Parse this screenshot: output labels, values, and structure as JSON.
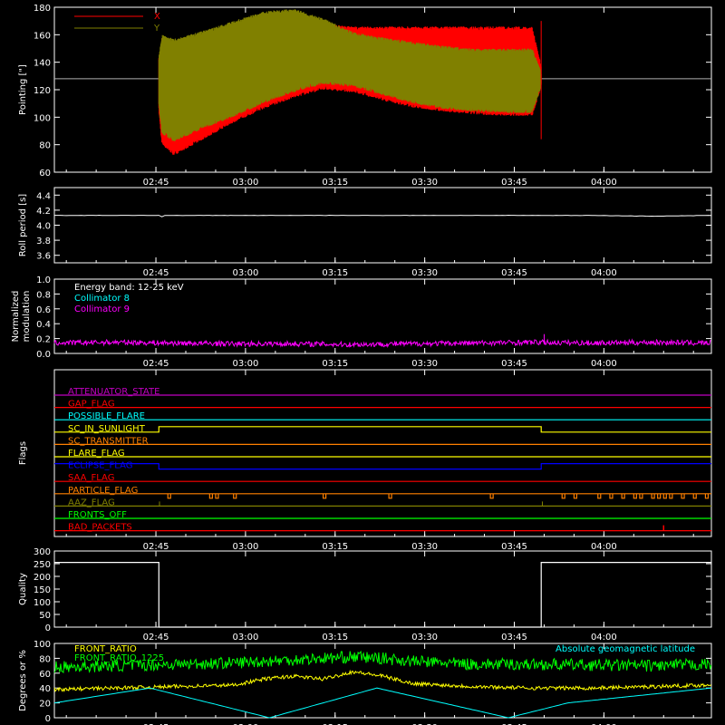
{
  "colors": {
    "background": "#000000",
    "axis": "#ffffff",
    "x_pointing": "#ff0000",
    "y_pointing": "#808000",
    "white": "#ffffff",
    "cyan": "#00ffff",
    "magenta": "#ff00ff",
    "green": "#00ff00",
    "yellow": "#ffff00",
    "orange": "#ff8000",
    "blue": "#0000ff",
    "purple": "#c000c0",
    "red": "#ff0000"
  },
  "time_axis": {
    "ticks": [
      "02:45",
      "03:00",
      "03:15",
      "03:30",
      "03:45",
      "04:00"
    ]
  },
  "chart_data": [
    {
      "id": "pointing",
      "type": "line",
      "ylabel": "Pointing [\"]",
      "ylim": [
        60,
        180
      ],
      "yticks": [
        "60",
        "80",
        "100",
        "120",
        "140",
        "160",
        "180"
      ],
      "xlim_minutes": [
        0,
        110
      ],
      "legend_placement": "top-left",
      "reference_line": 128,
      "series": [
        {
          "name": "X",
          "color": "#ff0000",
          "time_minutes": [
            0,
            17,
            18,
            20,
            25,
            30,
            35,
            40,
            45,
            50,
            55,
            60,
            65,
            70,
            75,
            80,
            82
          ],
          "upper": [
            128,
            128,
            158,
            152,
            158,
            164,
            170,
            170,
            168,
            166,
            166,
            166,
            166,
            166,
            166,
            166,
            128
          ],
          "lower": [
            128,
            128,
            80,
            72,
            84,
            96,
            106,
            114,
            120,
            118,
            112,
            107,
            104,
            102,
            101,
            101,
            128
          ]
        },
        {
          "name": "Y",
          "color": "#808000",
          "time_minutes": [
            0,
            17,
            18,
            20,
            25,
            30,
            35,
            40,
            45,
            50,
            55,
            60,
            65,
            70,
            75,
            80,
            82
          ],
          "upper": [
            128,
            128,
            160,
            157,
            163,
            170,
            177,
            179,
            172,
            162,
            158,
            155,
            152,
            150,
            150,
            150,
            128
          ],
          "lower": [
            128,
            128,
            88,
            82,
            92,
            100,
            110,
            118,
            124,
            122,
            116,
            110,
            106,
            104,
            103,
            103,
            128
          ]
        }
      ]
    },
    {
      "id": "roll_period",
      "type": "line",
      "ylabel": "Roll period [s]",
      "ylim": [
        3.5,
        4.5
      ],
      "yticks": [
        "3.6",
        "3.8",
        "4.0",
        "4.2",
        "4.4"
      ],
      "xlim_minutes": [
        0,
        110
      ],
      "series": [
        {
          "name": "",
          "color": "#ffffff",
          "time_minutes": [
            0,
            10,
            20,
            30,
            40,
            50,
            60,
            70,
            80,
            90,
            100,
            110
          ],
          "values": [
            4.13,
            4.13,
            4.13,
            4.13,
            4.13,
            4.13,
            4.13,
            4.13,
            4.13,
            4.13,
            4.12,
            4.13
          ]
        }
      ]
    },
    {
      "id": "modulation",
      "type": "line",
      "ylabel_lines": [
        "Normalized",
        "modulation"
      ],
      "ylim": [
        0,
        1.0
      ],
      "yticks": [
        "0.0",
        "0.2",
        "0.4",
        "0.6",
        "0.8",
        "1.0"
      ],
      "xlim_minutes": [
        0,
        110
      ],
      "legend": [
        {
          "label": "Energy band: 12-25 keV",
          "color": "#ffffff"
        },
        {
          "label": "Collimator 8",
          "color": "#00ffff"
        },
        {
          "label": "Collimator 9",
          "color": "#ff00ff"
        }
      ],
      "series": [
        {
          "name": "Collimator 9",
          "color": "#ff00ff",
          "time_minutes": [
            0,
            10,
            20,
            30,
            40,
            50,
            60,
            70,
            80,
            90,
            100,
            110
          ],
          "values": [
            0.14,
            0.15,
            0.14,
            0.13,
            0.13,
            0.12,
            0.13,
            0.14,
            0.15,
            0.14,
            0.15,
            0.14
          ]
        }
      ]
    },
    {
      "id": "flags",
      "type": "line",
      "ylabel": "Flags",
      "xlim_minutes": [
        0,
        110
      ],
      "rows": [
        {
          "label": "ATTENUATOR_STATE",
          "color": "#c000c0",
          "segments": [
            [
              0,
              110,
              0
            ]
          ]
        },
        {
          "label": "GAP_FLAG",
          "color": "#ff0000",
          "segments": [
            [
              0,
              110,
              0
            ]
          ]
        },
        {
          "label": "POSSIBLE_FLARE",
          "color": "#00ffff",
          "segments": [
            [
              0,
              110,
              0
            ]
          ]
        },
        {
          "label": "SC_IN_SUNLIGHT",
          "color": "#ffff00",
          "segments": [
            [
              0,
              17.5,
              0
            ],
            [
              17.5,
              81.5,
              1
            ],
            [
              81.5,
              110,
              0
            ]
          ]
        },
        {
          "label": "SC_TRANSMITTER",
          "color": "#ff8000",
          "segments": [
            [
              0,
              110,
              0
            ]
          ]
        },
        {
          "label": "FLARE_FLAG",
          "color": "#ffff00",
          "segments": [
            [
              0,
              110,
              0
            ]
          ]
        },
        {
          "label": "ECLIPSE_FLAG",
          "color": "#0000ff",
          "segments": [
            [
              0,
              17.5,
              1
            ],
            [
              17.5,
              81.5,
              0
            ],
            [
              81.5,
              110,
              1
            ]
          ]
        },
        {
          "label": "SAA_FLAG",
          "color": "#ff0000",
          "segments": [
            [
              0,
              110,
              0
            ]
          ]
        },
        {
          "label": "PARTICLE_FLAG",
          "color": "#ff8000",
          "segments": [
            [
              0,
              110,
              0
            ]
          ]
        },
        {
          "label": "AAZ_FLAG",
          "color": "#808000",
          "segments": [
            [
              0,
              110,
              0
            ]
          ]
        },
        {
          "label": "FRONTS_OFF",
          "color": "#00ff00",
          "segments": [
            [
              0,
              110,
              0
            ]
          ]
        },
        {
          "label": "BAD_PACKETS",
          "color": "#ff0000",
          "segments": [
            [
              0,
              110,
              0
            ]
          ]
        }
      ]
    },
    {
      "id": "quality",
      "type": "line",
      "ylabel": "Quality",
      "ylim": [
        0,
        300
      ],
      "yticks": [
        "0",
        "50",
        "100",
        "150",
        "200",
        "250",
        "300"
      ],
      "xlim_minutes": [
        0,
        110
      ],
      "series": [
        {
          "name": "",
          "color": "#ffffff",
          "time_minutes": [
            0,
            17.5,
            17.5,
            81.5,
            81.5,
            110
          ],
          "values": [
            255,
            255,
            0,
            0,
            255,
            255
          ]
        }
      ]
    },
    {
      "id": "ratio",
      "type": "line",
      "ylabel": "Degrees or %",
      "ylim": [
        0,
        100
      ],
      "yticks": [
        "0",
        "20",
        "40",
        "60",
        "80",
        "100"
      ],
      "xlim_minutes": [
        0,
        110
      ],
      "legend": [
        {
          "label": "FRONT_RATIO",
          "color": "#ffff00"
        },
        {
          "label": "FRONT_RATIO_1225",
          "color": "#00ff00"
        },
        {
          "label": "Absolute geomagnetic latitude",
          "color": "#00ffff"
        }
      ],
      "series": [
        {
          "name": "FRONT_RATIO_1225",
          "color": "#00ff00",
          "time_minutes": [
            0,
            10,
            20,
            30,
            40,
            50,
            55,
            60,
            70,
            80,
            90,
            100,
            110
          ],
          "values": [
            68,
            70,
            72,
            74,
            78,
            82,
            80,
            76,
            72,
            72,
            71,
            70,
            72
          ]
        },
        {
          "name": "FRONT_RATIO",
          "color": "#ffff00",
          "time_minutes": [
            0,
            10,
            20,
            30,
            35,
            40,
            45,
            50,
            55,
            60,
            70,
            80,
            90,
            100,
            110
          ],
          "values": [
            38,
            40,
            42,
            44,
            52,
            56,
            52,
            62,
            56,
            46,
            42,
            40,
            40,
            42,
            44
          ]
        },
        {
          "name": "Absolute geomagnetic latitude",
          "color": "#00ffff",
          "time_minutes": [
            0,
            16,
            36,
            54,
            76,
            86,
            110
          ],
          "values": [
            20,
            40,
            0,
            40,
            0,
            20,
            40
          ]
        }
      ]
    }
  ]
}
